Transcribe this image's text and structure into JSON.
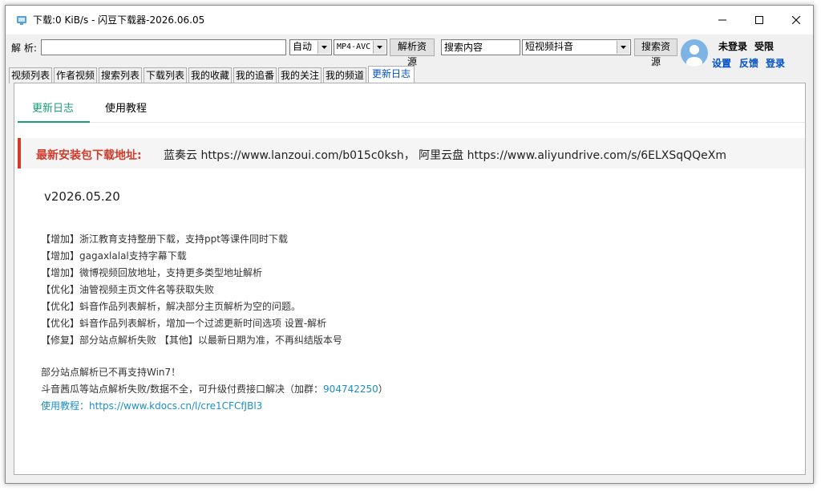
{
  "window": {
    "title": "下载:0 KiB/s - 闪豆下载器-2026.06.05",
    "icon": "app-icon"
  },
  "toolbar": {
    "parse_label": "解 析:",
    "parse_value": "",
    "quality_select": "自动",
    "format_select": "MP4-AVC",
    "parse_button": "解析资源",
    "search_value": "搜索内容",
    "platform_select": "短视频抖音",
    "search_button": "搜索资源"
  },
  "user": {
    "status": "未登录",
    "privilege": "受限",
    "settings": "设置",
    "feedback": "反馈",
    "login": "登录"
  },
  "tabs": [
    "视频列表",
    "作者视频",
    "搜索列表",
    "下载列表",
    "我的收藏",
    "我的追番",
    "我的关注",
    "我的频道",
    "更新日志"
  ],
  "active_tab": "更新日志",
  "subtabs": [
    "更新日志",
    "使用教程"
  ],
  "notice": {
    "title": "最新安装包下载地址:",
    "text": "蓝奏云 https://www.lanzoui.com/b015c0ksh， 阿里云盘 https://www.aliyundrive.com/s/6ELXSqQQeXm"
  },
  "version": "v2026.05.20",
  "log": [
    "【增加】浙江教育支持整册下载，支持ppt等课件同时下载",
    "【增加】gagaxlalal支持字幕下载",
    "【增加】微博视频回放地址，支持更多类型地址解析",
    "【优化】油管视频主页文件名等获取失败",
    "【优化】蚪音作品列表解析，解决部分主页解析为空的问题。",
    "【优化】蚪音作品列表解析，增加一个过滤更新时间选项 设置-解析",
    "【修复】部分站点解析失败 【其他】以最新日期为准，不再纠结版本号"
  ],
  "footer": {
    "line1": "部分站点解析已不再支持Win7！",
    "line2_prefix": "斗音茜瓜等站点解析失败/数据不全，可升级付费接口解决（加群：",
    "line2_group": "904742250",
    "line2_suffix": "）",
    "tutorial_label": "使用教程：",
    "tutorial_url": "https://www.kdocs.cn/l/cre1CFCfJBl3"
  },
  "colors": {
    "accent_green": "#1a9e78",
    "notice_red": "#d23b2c",
    "link_blue": "#0050c8",
    "link_teal": "#1a8fc9"
  }
}
